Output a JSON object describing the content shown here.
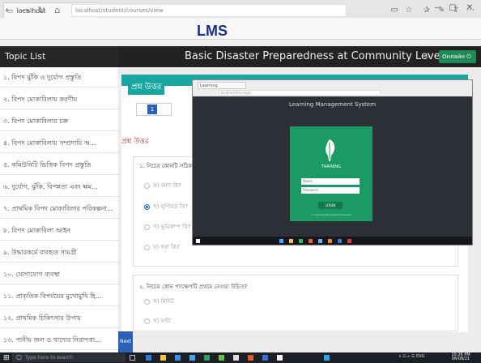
{
  "browser": {
    "tab_title": "localhost",
    "tab_close": "×",
    "new_tab": "+",
    "url": "localhost/student/courses/view",
    "overlay_title": "LMS",
    "window_controls": [
      "–",
      "▢",
      "✕"
    ]
  },
  "app": {
    "sidebar_title": "Topic List",
    "course_title": "Basic Disaster Preparedness at Community Level",
    "header_button": "Онлайн ⏻"
  },
  "sidebar": {
    "items": [
      {
        "label": "১. বিপদ ঝুঁকি ও দুর্যোগ প্রস্তুতি"
      },
      {
        "label": "২. বিপদ মোকাবিলায় করণীয়"
      },
      {
        "label": "৩. বিপদ মোকাবিলার চক্র"
      },
      {
        "label": "৪. বিপদ মোকাবিলায় সম্প্রদায়ি অ..."
      },
      {
        "label": "৫. কমিউনিটি ভিত্তিক বিপদ প্রস্তুতি"
      },
      {
        "label": "৬. দুর্যোগ, ঝুঁকি, বিপন্নতা এবং ক্ষম..."
      },
      {
        "label": "৭. প্রাথমিক বিপদ মোকাবিলার পরিকল্পনা..."
      },
      {
        "label": "৮. বিপদ মোকাবিলা আইন"
      },
      {
        "label": "৯. উদ্ধারকর্মে ব্যবহৃত সামগ্রী"
      },
      {
        "label": "১০. যোগাযোগ ব্যবস্থা"
      },
      {
        "label": "১১. প্রাকৃতিক বিপর্যয়ের মুখোমুখি হি..."
      },
      {
        "label": "১২. প্রাথমিক চিকিৎসার উপায়"
      },
      {
        "label": "১৩. পানীয় জল ও খাদ্যের নিরাপত্তা..."
      }
    ]
  },
  "main": {
    "card_header": "প্রশ্ন উত্তর",
    "page_number": "1",
    "section_label": "প্রশ্ন উত্তর",
    "question1": {
      "text": "১. নিচের কোনটি সঠিক?",
      "options": [
        "ক) বন্যা কি?",
        "খ) ঘূর্ণিঝড় কি?",
        "গ) ভূমিকম্প কি?",
        "ঘ) খরা কি?"
      ]
    },
    "question2": {
      "text": "২. নিচের কোন পদক্ষেপটি প্রথমে নেওয়া উচিত?",
      "options": [
        "ক) মিনিট",
        "খ) ঘণ্টা"
      ]
    },
    "next_button": "Next"
  },
  "embedded": {
    "tab": "Learning",
    "url": "localhost/lms/login",
    "title": "Learning Management System",
    "brand": "TRAINING",
    "username_placeholder": "Name",
    "password_placeholder": "Password",
    "login_button": "LOGIN",
    "footer": "© Learning Management System"
  },
  "taskbar": {
    "search_placeholder": "Type here to search",
    "tray": "∧ ⊡ ⌂ ☰ ENG",
    "time": "10:26 PM",
    "date": "06/08/21"
  }
}
